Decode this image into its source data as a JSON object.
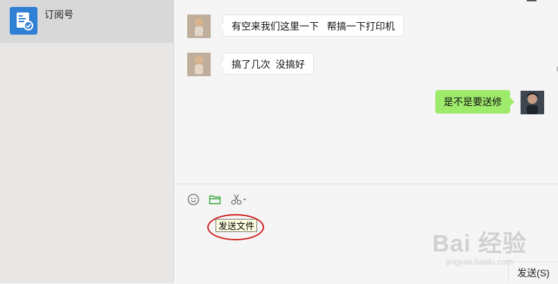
{
  "sidebar": {
    "subscription": {
      "label": "订阅号",
      "icon": "subscription-icon"
    }
  },
  "chat": {
    "messages": [
      {
        "side": "left",
        "text": "有空来我们这里一下   帮搞一下打印机"
      },
      {
        "side": "left",
        "text": "搞了几次  没搞好"
      },
      {
        "side": "right",
        "text": "是不是要送修"
      }
    ]
  },
  "input_area": {
    "toolbar": {
      "emoji_icon": "emoji-icon",
      "file_icon": "folder-icon",
      "screenshot_icon": "scissors-icon"
    },
    "tooltip": "发送文件",
    "send_label": "发送(S)"
  },
  "watermark": {
    "main": "Bai 经验",
    "sub": "jingyan.baidu.com"
  },
  "colors": {
    "accent_green": "#9eea6a",
    "file_icon_green": "#2fa536",
    "highlight_red": "#d01c1c"
  }
}
